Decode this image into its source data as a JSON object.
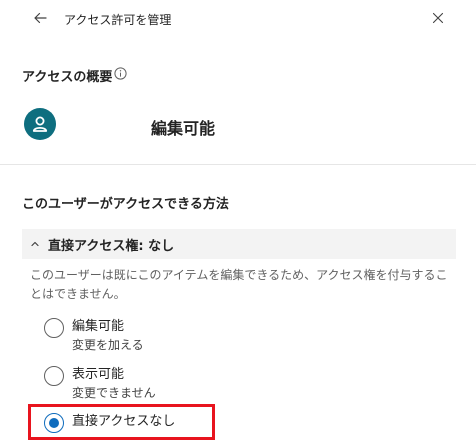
{
  "header": {
    "title": "アクセス許可を管理",
    "back_icon": "arrow-left-icon",
    "close_icon": "close-icon"
  },
  "overview": {
    "label": "アクセスの概要",
    "info_icon": "info-icon",
    "avatar_icon": "person-icon",
    "avatar_color": "#0e6e7f",
    "permission": "編集可能"
  },
  "access_method": {
    "label": "このユーザーがアクセスできる方法",
    "section": {
      "title": "直接アクセス権: なし",
      "expanded": true,
      "description": "このユーザーは既にこのアイテムを編集できるため、アクセス権を付与することはできません。",
      "options": [
        {
          "label": "編集可能",
          "sub": "変更を加える",
          "checked": false
        },
        {
          "label": "表示可能",
          "sub": "変更できません",
          "checked": false
        },
        {
          "label": "直接アクセスなし",
          "sub": "",
          "checked": true
        }
      ]
    }
  },
  "colors": {
    "accent": "#0f6cbd",
    "highlight": "#e8141e"
  }
}
